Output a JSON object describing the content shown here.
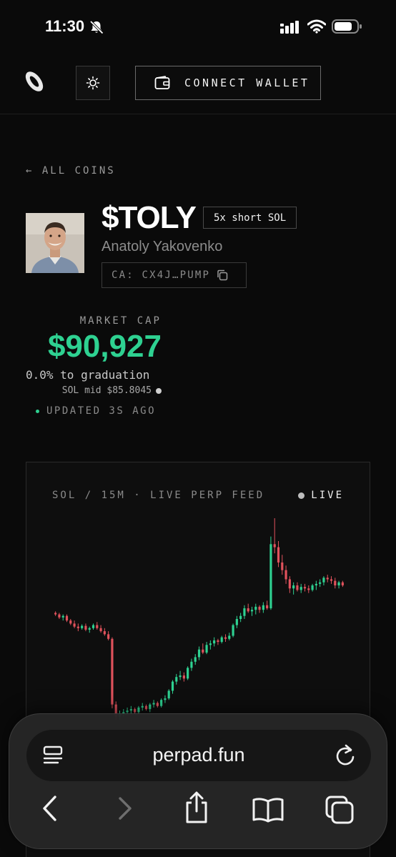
{
  "status": {
    "time": "11:30"
  },
  "header": {
    "wallet_label": "CONNECT WALLET"
  },
  "coin": {
    "back_label": "← ALL COINS",
    "ticker": "$TOLY",
    "tag": "5x short SOL",
    "dev_name": "Anatoly Yakovenko",
    "ca": "CA: CX4J…PUMP"
  },
  "stats": {
    "mc_label": "MARKET CAP",
    "mc_value": "$90,927",
    "graduation": "0.0% to graduation",
    "sol_mid": "SOL mid $85.8045",
    "updated": "UPDATED 3S AGO"
  },
  "chart": {
    "title": "SOL / 15M · LIVE PERP FEED",
    "live_label": "LIVE"
  },
  "chart_data": {
    "type": "candlestick",
    "title": "SOL / 15M · LIVE PERP FEED",
    "colors": {
      "up": "#2ed191",
      "down": "#e0525c"
    },
    "candles": [
      [
        86.1,
        86.12,
        86.06,
        86.08
      ],
      [
        86.08,
        86.1,
        86.02,
        86.04
      ],
      [
        86.04,
        86.08,
        86.0,
        86.06
      ],
      [
        86.06,
        86.08,
        85.98,
        86.0
      ],
      [
        86.0,
        86.02,
        85.94,
        85.96
      ],
      [
        85.96,
        86.0,
        85.9,
        85.92
      ],
      [
        85.92,
        85.96,
        85.86,
        85.9
      ],
      [
        85.9,
        85.95,
        85.88,
        85.93
      ],
      [
        85.93,
        85.96,
        85.86,
        85.88
      ],
      [
        85.88,
        85.92,
        85.84,
        85.9
      ],
      [
        85.9,
        85.96,
        85.88,
        85.94
      ],
      [
        85.94,
        85.98,
        85.88,
        85.9
      ],
      [
        85.9,
        85.94,
        85.84,
        85.86
      ],
      [
        85.86,
        85.9,
        85.8,
        85.82
      ],
      [
        85.82,
        85.86,
        85.74,
        85.76
      ],
      [
        85.76,
        85.78,
        84.85,
        84.9
      ],
      [
        84.9,
        84.94,
        84.7,
        84.74
      ],
      [
        84.74,
        84.82,
        84.7,
        84.78
      ],
      [
        84.78,
        84.84,
        84.74,
        84.8
      ],
      [
        84.8,
        84.86,
        84.76,
        84.82
      ],
      [
        84.82,
        84.88,
        84.78,
        84.84
      ],
      [
        84.84,
        84.86,
        84.78,
        84.8
      ],
      [
        84.8,
        84.88,
        84.78,
        84.86
      ],
      [
        84.86,
        84.92,
        84.82,
        84.88
      ],
      [
        84.88,
        84.9,
        84.82,
        84.84
      ],
      [
        84.84,
        84.92,
        84.8,
        84.9
      ],
      [
        84.9,
        84.96,
        84.86,
        84.92
      ],
      [
        84.92,
        84.94,
        84.86,
        84.88
      ],
      [
        84.88,
        84.98,
        84.86,
        84.96
      ],
      [
        84.96,
        85.02,
        84.92,
        84.98
      ],
      [
        84.98,
        85.1,
        84.96,
        85.08
      ],
      [
        85.08,
        85.22,
        85.04,
        85.2
      ],
      [
        85.2,
        85.3,
        85.16,
        85.26
      ],
      [
        85.26,
        85.34,
        85.22,
        85.28
      ],
      [
        85.28,
        85.32,
        85.2,
        85.24
      ],
      [
        85.24,
        85.4,
        85.22,
        85.38
      ],
      [
        85.38,
        85.5,
        85.34,
        85.46
      ],
      [
        85.46,
        85.56,
        85.42,
        85.52
      ],
      [
        85.52,
        85.66,
        85.48,
        85.62
      ],
      [
        85.62,
        85.7,
        85.56,
        85.58
      ],
      [
        85.58,
        85.72,
        85.56,
        85.68
      ],
      [
        85.68,
        85.74,
        85.62,
        85.7
      ],
      [
        85.7,
        85.78,
        85.66,
        85.74
      ],
      [
        85.74,
        85.76,
        85.68,
        85.72
      ],
      [
        85.72,
        85.8,
        85.7,
        85.78
      ],
      [
        85.78,
        85.82,
        85.72,
        85.76
      ],
      [
        85.76,
        85.84,
        85.74,
        85.8
      ],
      [
        85.8,
        85.96,
        85.78,
        85.94
      ],
      [
        85.94,
        86.06,
        85.9,
        86.02
      ],
      [
        86.02,
        86.1,
        85.98,
        86.06
      ],
      [
        86.06,
        86.2,
        86.02,
        86.16
      ],
      [
        86.16,
        86.22,
        86.1,
        86.12
      ],
      [
        86.12,
        86.18,
        86.06,
        86.14
      ],
      [
        86.14,
        86.22,
        86.08,
        86.18
      ],
      [
        86.18,
        86.2,
        86.1,
        86.14
      ],
      [
        86.14,
        86.24,
        86.1,
        86.2
      ],
      [
        86.2,
        86.26,
        86.14,
        86.16
      ],
      [
        86.16,
        87.1,
        86.14,
        87.0
      ],
      [
        87.0,
        87.34,
        86.88,
        86.96
      ],
      [
        86.96,
        87.04,
        86.7,
        86.76
      ],
      [
        86.76,
        86.86,
        86.6,
        86.66
      ],
      [
        86.66,
        86.72,
        86.48,
        86.54
      ],
      [
        86.54,
        86.58,
        86.36,
        86.42
      ],
      [
        86.42,
        86.5,
        86.34,
        86.46
      ],
      [
        86.46,
        86.5,
        86.38,
        86.4
      ],
      [
        86.4,
        86.48,
        86.36,
        86.44
      ],
      [
        86.44,
        86.48,
        86.38,
        86.42
      ],
      [
        86.42,
        86.46,
        86.36,
        86.4
      ],
      [
        86.4,
        86.48,
        86.38,
        86.46
      ],
      [
        86.46,
        86.52,
        86.4,
        86.48
      ],
      [
        86.48,
        86.54,
        86.44,
        86.5
      ],
      [
        86.5,
        86.58,
        86.46,
        86.56
      ],
      [
        86.56,
        86.6,
        86.5,
        86.54
      ],
      [
        86.54,
        86.58,
        86.48,
        86.52
      ],
      [
        86.52,
        86.56,
        86.42,
        86.46
      ],
      [
        86.46,
        86.52,
        86.42,
        86.5
      ],
      [
        86.5,
        86.52,
        86.44,
        86.46
      ]
    ]
  }
}
